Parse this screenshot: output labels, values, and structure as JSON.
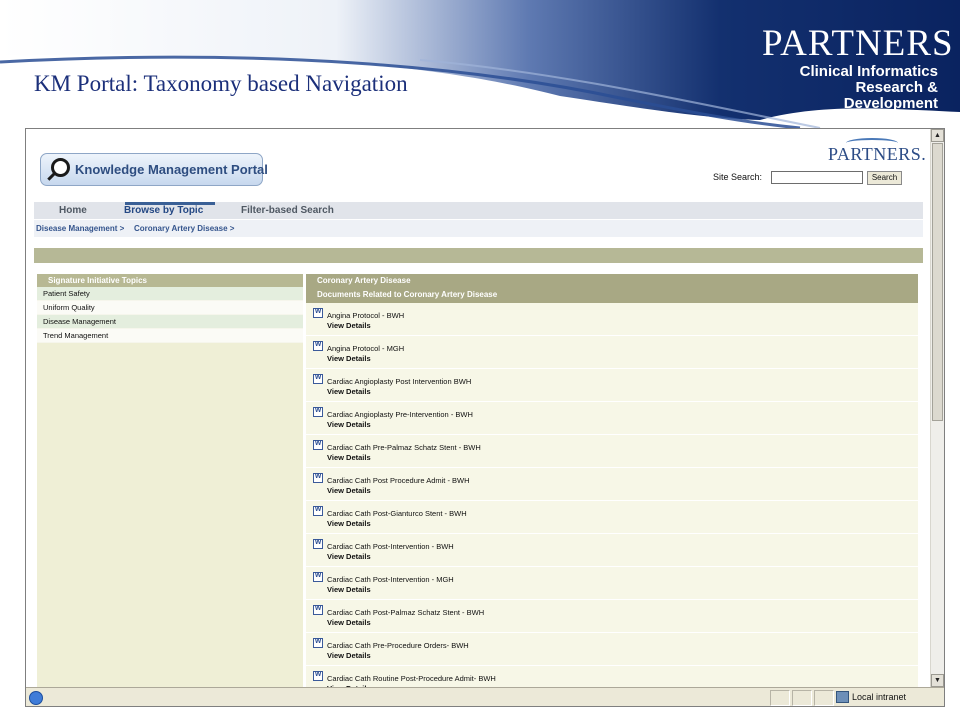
{
  "slide": {
    "title": "KM Portal: Taxonomy based Navigation",
    "logo": {
      "wordmark": "PARTNERS",
      "line1": "Clinical Informatics",
      "line2": "Research & Development"
    }
  },
  "portal": {
    "logo_text": "Knowledge Management Portal",
    "partners_logo": "PARTNERS.",
    "search": {
      "label": "Site Search:",
      "value": "",
      "button": "Search"
    },
    "nav_tabs": [
      {
        "label": "Home",
        "active": false
      },
      {
        "label": "Browse by Topic",
        "active": true
      },
      {
        "label": "Filter-based Search",
        "active": false
      }
    ],
    "breadcrumb": [
      "Disease Management >",
      "Coronary Artery Disease >"
    ],
    "topics": {
      "header": "Signature Initiative Topics",
      "items": [
        "Patient Safety",
        "Uniform Quality",
        "Disease Management",
        "Trend Management"
      ]
    },
    "documents": {
      "header1": "Coronary Artery Disease",
      "header2": "Documents Related to Coronary Artery Disease",
      "link_label": "View Details",
      "items": [
        "Angina Protocol - BWH",
        "Angina Protocol - MGH",
        "Cardiac Angioplasty Post Intervention BWH",
        "Cardiac Angioplasty Pre-Intervention - BWH",
        "Cardiac Cath Pre-Palmaz Schatz Stent - BWH",
        "Cardiac Cath Post Procedure Admit - BWH",
        "Cardiac Cath Post-Gianturco Stent - BWH",
        "Cardiac Cath Post-Intervention - BWH",
        "Cardiac Cath Post-Intervention - MGH",
        "Cardiac Cath Post-Palmaz Schatz Stent - BWH",
        "Cardiac Cath Pre-Procedure Orders- BWH",
        "Cardiac Cath Routine Post-Procedure Admit- BWH"
      ]
    }
  },
  "browser": {
    "status_zone": "Local intranet"
  },
  "colors": {
    "banner_navy": "#0d2a6e",
    "slide_title": "#1b2f7a",
    "olive_header": "#a8a884",
    "nav_active": "#244884"
  },
  "icons": [
    "search-magnifier-icon",
    "word-document-icon",
    "ie-page-icon",
    "intranet-zone-icon"
  ]
}
